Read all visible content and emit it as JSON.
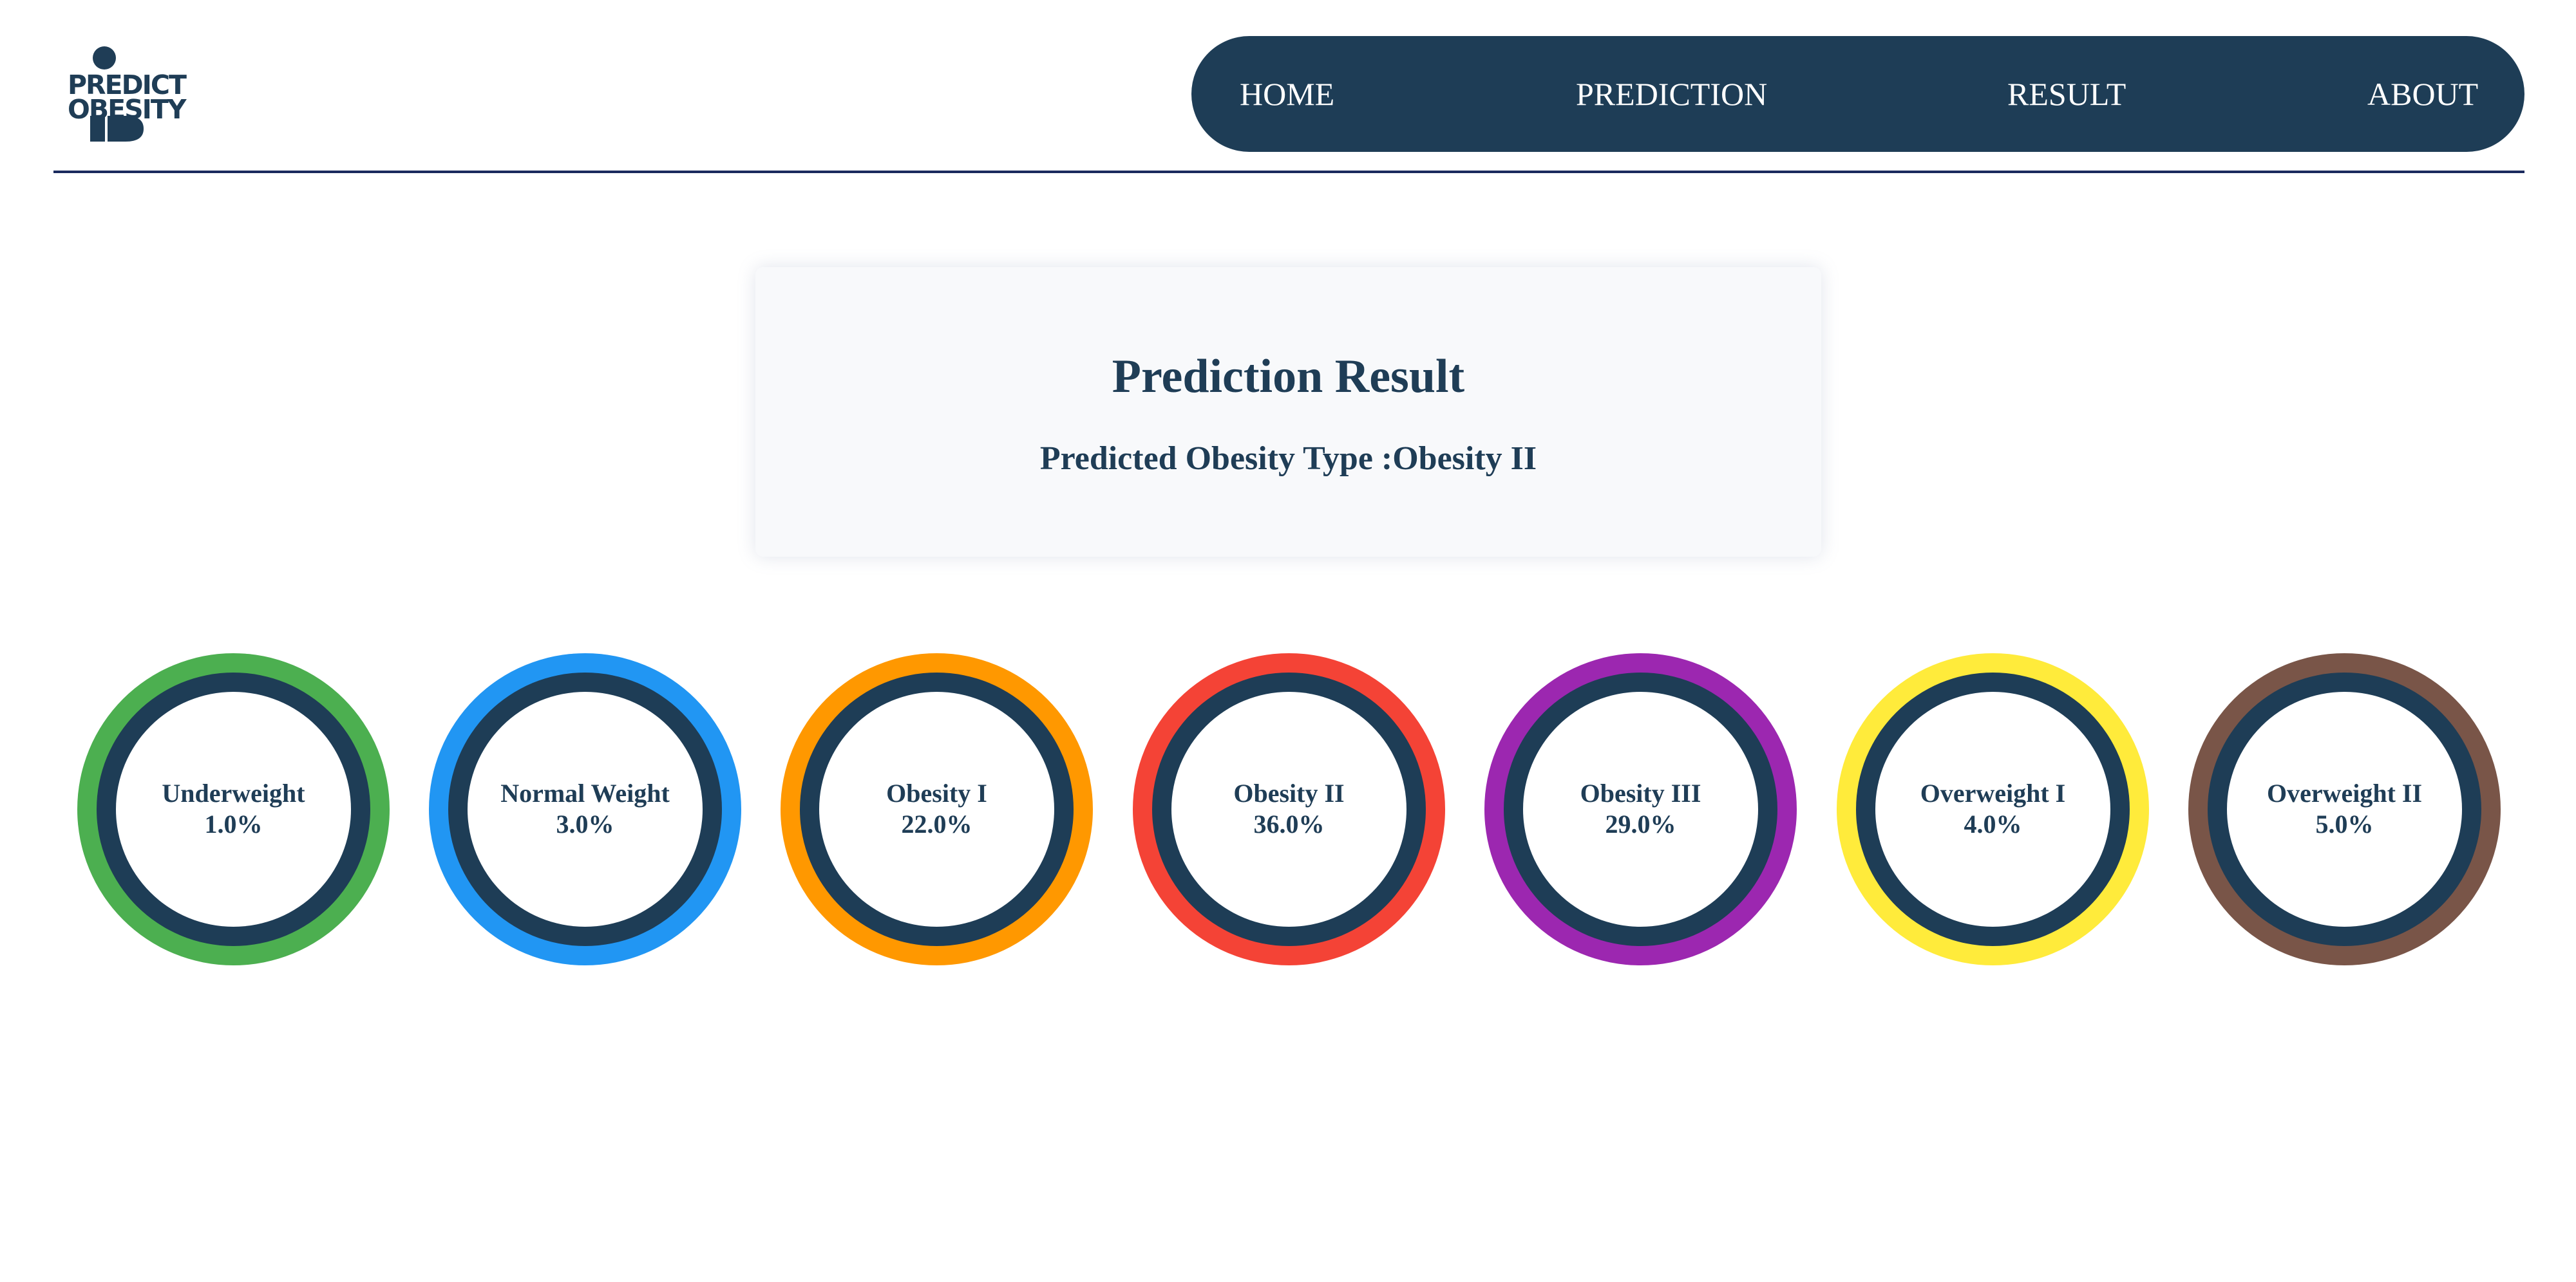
{
  "header": {
    "logo_text_line1": "PREDICT",
    "logo_text_line2": "OBESITY",
    "logo_icon": "person-icon",
    "nav": {
      "home": "HOME",
      "prediction": "PREDICTION",
      "result": "RESULT",
      "about": "ABOUT"
    },
    "nav_bg_color": "#1e3d56"
  },
  "result": {
    "title": "Prediction Result",
    "predicted_type": "Predicted Obesity Type :Obesity II"
  },
  "categories": [
    {
      "label": "Underweight",
      "value": "1.0%",
      "color": "#4caf50"
    },
    {
      "label": "Normal Weight",
      "value": "3.0%",
      "color": "#2196f3"
    },
    {
      "label": "Obesity I",
      "value": "22.0%",
      "color": "#ff9800"
    },
    {
      "label": "Obesity II",
      "value": "36.0%",
      "color": "#f44336"
    },
    {
      "label": "Obesity III",
      "value": "29.0%",
      "color": "#9c27b0"
    },
    {
      "label": "Overweight I",
      "value": "4.0%",
      "color": "#ffeb3b"
    },
    {
      "label": "Overweight II",
      "value": "5.0%",
      "color": "#795548"
    }
  ]
}
